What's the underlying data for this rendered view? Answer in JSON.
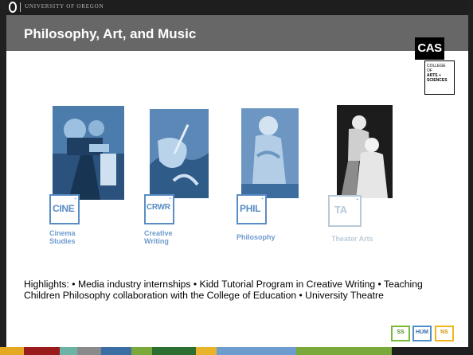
{
  "header": {
    "university": "University of Oregon"
  },
  "slide": {
    "title": "Philosophy, Art, and Music"
  },
  "cas": {
    "badge": "CAS",
    "lines": [
      "COLLEGE",
      "OF",
      "ARTS +",
      "SCIENCES"
    ]
  },
  "programs": [
    {
      "code": "CINE",
      "name_line1": "Cinema",
      "name_line2": "Studies"
    },
    {
      "code": "CRWR",
      "name_line1": "Creative",
      "name_line2": "Writing"
    },
    {
      "code": "PHIL",
      "name_line1": "Philosophy",
      "name_line2": ""
    },
    {
      "code": "TA",
      "name_line1": "Theater Arts",
      "name_line2": ""
    }
  ],
  "highlights": "Highlights: • Media industry internships • Kidd Tutorial Program in Creative Writing • Teaching Children Philosophy collaboration with the College of Education • University Theatre",
  "footer": {
    "tags": [
      {
        "code": "SS",
        "color": "#79b83d"
      },
      {
        "code": "HUM",
        "color": "#4d8ecb"
      },
      {
        "code": "NS",
        "color": "#f3b51c"
      }
    ]
  },
  "colors": {
    "title_band": "#676767",
    "program_blue": "#5a8dc4",
    "strip": [
      "#e4a822",
      "#9a1b1b",
      "#6db3a5",
      "#8a8a8a",
      "#3a6ea5",
      "#2c6e2f",
      "#7aa83a",
      "#e8b32a",
      "#6f9ccf",
      "#7aa83a"
    ]
  }
}
